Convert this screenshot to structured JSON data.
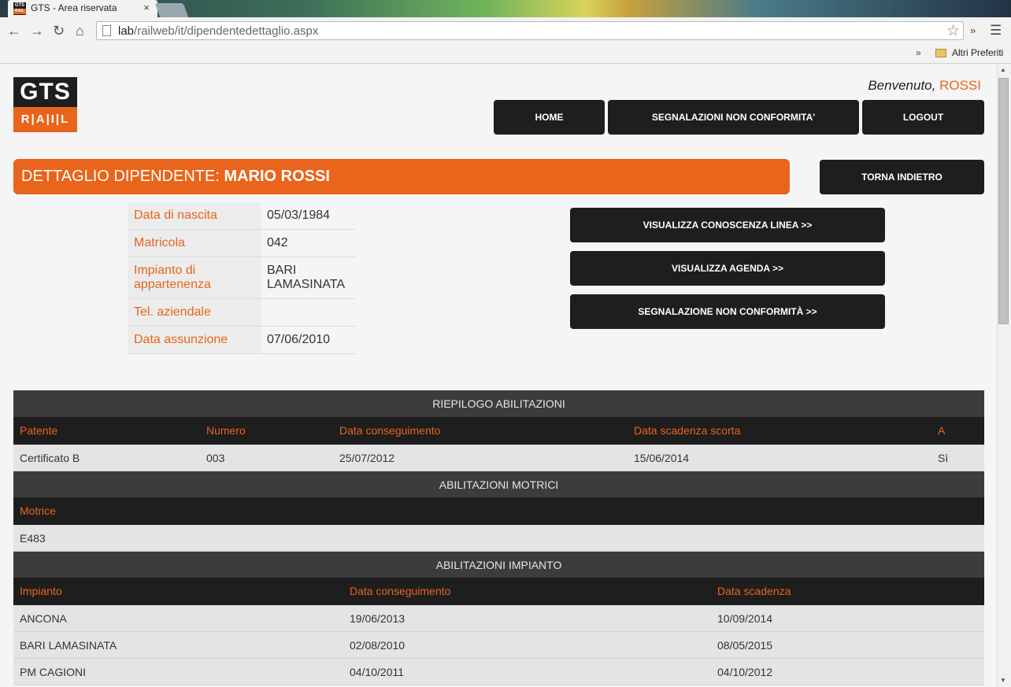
{
  "browser": {
    "tab_title": "GTS - Area riservata",
    "tab_close": "×",
    "url_host": "lab",
    "url_path": "/railweb/it/dipendentedettaglio.aspx",
    "bookmarks_overflow": "»",
    "extensions_overflow": "»",
    "bookmark_folder": "Altri Preferiti",
    "favicon_top": "GTS",
    "favicon_bottom": "RAIL"
  },
  "logo": {
    "top": "GTS",
    "bottom": "R|A|I|L"
  },
  "header": {
    "welcome_prefix": "Benvenuto, ",
    "welcome_user": "ROSSI",
    "nav": [
      "HOME",
      "SEGNALAZIONI NON CONFORMITA'",
      "LOGOUT"
    ]
  },
  "title": {
    "prefix": "DETTAGLIO DIPENDENTE: ",
    "name": "MARIO ROSSI",
    "back_button": "TORNA INDIETRO"
  },
  "employee": {
    "dob_label": "Data di nascita",
    "dob": "05/03/1984",
    "matricola_label": "Matricola",
    "matricola": "042",
    "impianto_label_1": "Impianto di",
    "impianto_label_2": "appartenenza",
    "impianto_1": "BARI",
    "impianto_2": "LAMASINATA",
    "tel_label": "Tel. aziendale",
    "tel": "",
    "assunzione_label": "Data assunzione",
    "assunzione": "07/06/2010"
  },
  "actions": [
    "VISUALIZZA CONOSCENZA LINEA >>",
    "VISUALIZZA AGENDA >>",
    "SEGNALAZIONE NON CONFORMITÀ >>"
  ],
  "riepilogo": {
    "title": "RIEPILOGO ABILITAZIONI",
    "columns": [
      "Patente",
      "Numero",
      "Data conseguimento",
      "Data scadenza scorta",
      "A"
    ],
    "rows": [
      [
        "Certificato B",
        "003",
        "25/07/2012",
        "15/06/2014",
        "Sì"
      ]
    ]
  },
  "motrici": {
    "title": "ABILITAZIONI MOTRICI",
    "columns": [
      "Motrice"
    ],
    "rows": [
      [
        "E483"
      ]
    ]
  },
  "impianto": {
    "title": "ABILITAZIONI IMPIANTO",
    "columns": [
      "Impianto",
      "Data conseguimento",
      "Data scadenza"
    ],
    "rows": [
      [
        "ANCONA",
        "19/06/2013",
        "10/09/2014"
      ],
      [
        "BARI LAMASINATA",
        "02/08/2010",
        "08/05/2015"
      ],
      [
        "PM CAGIONI",
        "04/10/2011",
        "04/10/2012"
      ]
    ]
  },
  "colors": {
    "accent": "#e8651b",
    "dark": "#1e1e1e",
    "section": "#3c3c3c"
  }
}
